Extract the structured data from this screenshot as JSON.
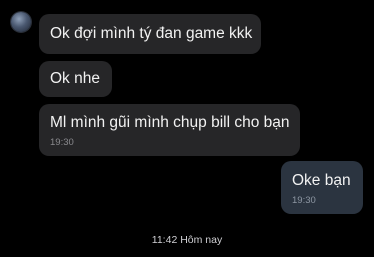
{
  "contact": {
    "avatar_icon": "avatar-photo"
  },
  "messages": [
    {
      "text": "Ok đợi mình tý đan game kkk",
      "time": ""
    },
    {
      "text": "Ok nhe",
      "time": ""
    },
    {
      "text": "Ml mình gũi mình chụp bill cho bạn",
      "time": "19:30"
    },
    {
      "text": "Oke bạn",
      "time": "19:30"
    }
  ],
  "timestamp_divider": "11:42 Hôm nay",
  "colors": {
    "background": "#000000",
    "incoming_bubble": "#262628",
    "outgoing_bubble": "#2b3440",
    "text": "#f2f2f2",
    "meta": "#8a8a8e"
  }
}
